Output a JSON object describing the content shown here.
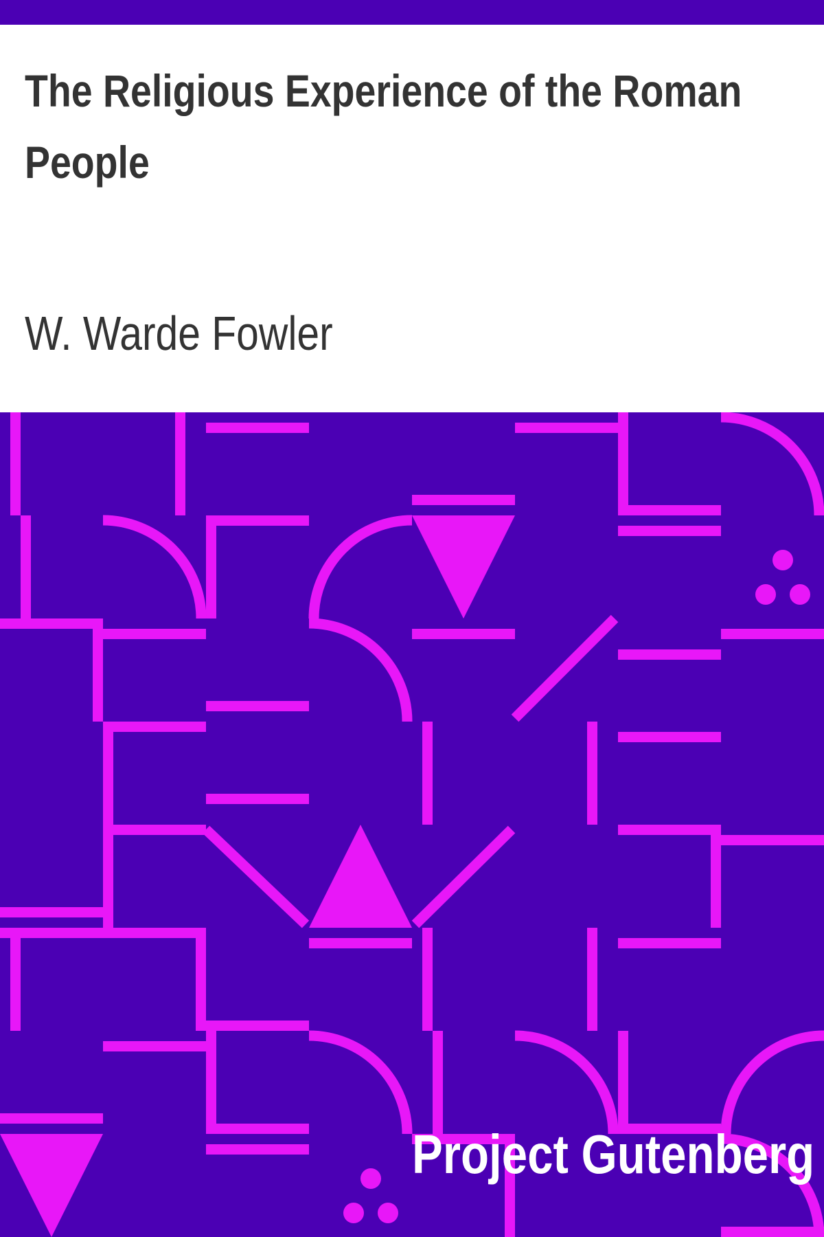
{
  "cover": {
    "title": "The Religious Experience of the Roman People",
    "author": "W. Warde Fowler",
    "publisher": "Project Gutenberg"
  },
  "colors": {
    "background": "#ffffff",
    "text": "#333333",
    "pattern_background": "#4b00b4",
    "pattern_foreground": "#e817f8",
    "publisher_text": "#ffffff"
  },
  "icons": [
    "inverted-triangle",
    "triangle",
    "three-dots",
    "quarter-arc",
    "line-segment"
  ]
}
